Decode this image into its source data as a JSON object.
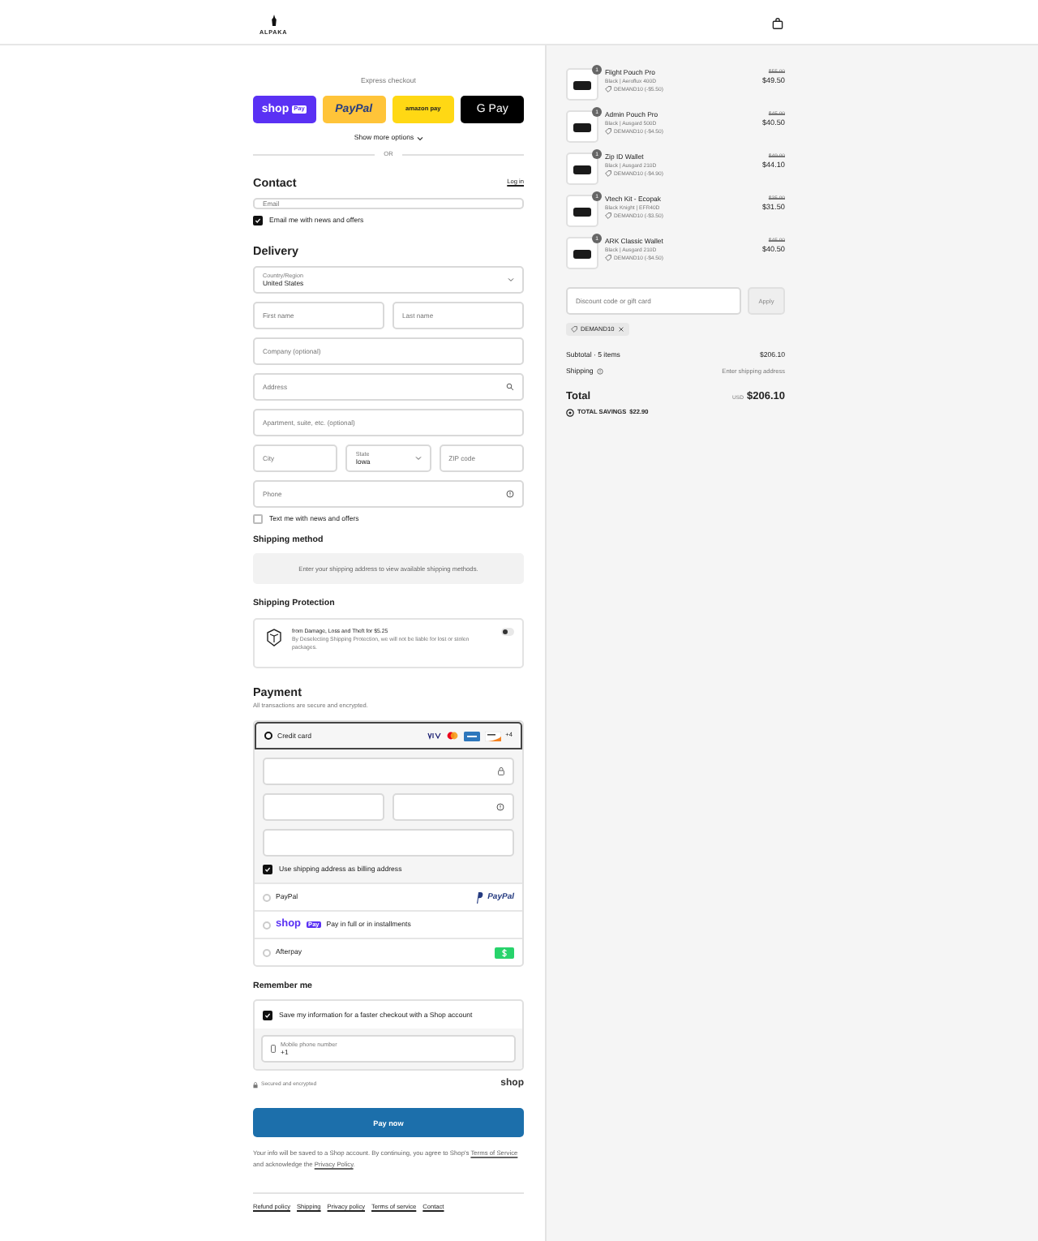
{
  "header": {
    "logo": "ALPAKA"
  },
  "express": {
    "label": "Express checkout",
    "buttons": [
      {
        "kind": "shop",
        "label": "shop",
        "badge": "Pay"
      },
      {
        "kind": "paypal",
        "label": "PayPal"
      },
      {
        "kind": "amazon",
        "label": "amazon pay"
      },
      {
        "kind": "gpay",
        "label": "G Pay"
      }
    ],
    "show_more": "Show more options",
    "divider": "OR"
  },
  "contact": {
    "heading": "Contact",
    "login": "Log in",
    "email": {
      "placeholder": "Email"
    },
    "news": {
      "label": "Email me with news and offers",
      "checked": true
    }
  },
  "delivery": {
    "heading": "Delivery",
    "rows": [
      [
        {
          "kind": "select",
          "label": "Country/Region",
          "value": "United States"
        }
      ],
      [
        {
          "kind": "text",
          "placeholder": "First name"
        },
        {
          "kind": "text",
          "placeholder": "Last name"
        }
      ],
      [
        {
          "kind": "text",
          "placeholder": "Company (optional)"
        }
      ],
      [
        {
          "kind": "search",
          "placeholder": "Address"
        }
      ],
      [
        {
          "kind": "text",
          "placeholder": "Apartment, suite, etc. (optional)"
        }
      ],
      [
        {
          "kind": "text",
          "placeholder": "City"
        },
        {
          "kind": "select",
          "label": "State",
          "value": "Iowa"
        },
        {
          "kind": "text",
          "placeholder": "ZIP code"
        }
      ],
      [
        {
          "kind": "help",
          "placeholder": "Phone"
        }
      ]
    ],
    "sms": {
      "label": "Text me with news and offers",
      "checked": false
    }
  },
  "shipping_method": {
    "heading": "Shipping method",
    "message": "Enter your shipping address to view available shipping methods."
  },
  "shipping_protection": {
    "heading": "Shipping Protection",
    "title": "from Damage, Loss and Theft for $5.25",
    "description": "By Deselecting Shipping Protection, we will not be liable for lost or stolen packages.",
    "on": false
  },
  "payment": {
    "heading": "Payment",
    "subtitle": "All transactions are secure and encrypted.",
    "more_cards": "+4",
    "card_fields": [
      [
        {
          "kind": "lock"
        }
      ],
      [
        {
          "kind": "plain"
        },
        {
          "kind": "help"
        }
      ],
      [
        {
          "kind": "plain"
        }
      ]
    ],
    "billing": {
      "label": "Use shipping address as billing address",
      "checked": true
    },
    "methods": [
      {
        "kind": "card",
        "label": "Credit card",
        "selected": true
      },
      {
        "kind": "paypal",
        "label": "PayPal",
        "logo": "PayPal",
        "selected": false
      },
      {
        "kind": "shop",
        "logo": "shop",
        "badge": "Pay",
        "label": "Pay in full or in installments",
        "selected": false
      },
      {
        "kind": "afterpay",
        "label": "Afterpay",
        "selected": false
      }
    ]
  },
  "remember": {
    "heading": "Remember me",
    "save": {
      "label": "Save my information for a faster checkout with a Shop account",
      "checked": true
    },
    "phone": {
      "label": "Mobile phone number",
      "value": "+1"
    },
    "secured": "Secured and encrypted",
    "shop_logo": "shop"
  },
  "pay_button": "Pay now",
  "disclaimer": {
    "text": "Your info will be saved to a Shop account. By continuing, you agree to Shop's",
    "terms": "Terms of Service",
    "middle": "and acknowledge the",
    "privacy": "Privacy Policy",
    "end": "."
  },
  "footer_links": [
    "Refund policy",
    "Shipping",
    "Privacy policy",
    "Terms of service",
    "Contact"
  ],
  "summary": {
    "items": [
      {
        "name": "Flight Pouch Pro",
        "variant": "Black | Aeroflux 400D",
        "discount": "DEMAND10 (-$5.50)",
        "original": "$55.00",
        "price": "$49.50",
        "quantity": "1"
      },
      {
        "name": "Admin Pouch Pro",
        "variant": "Black | Ausgard 500D",
        "discount": "DEMAND10 (-$4.50)",
        "original": "$45.00",
        "price": "$40.50",
        "quantity": "1"
      },
      {
        "name": "Zip ID Wallet",
        "variant": "Black | Ausgard 210D",
        "discount": "DEMAND10 (-$4.90)",
        "original": "$49.00",
        "price": "$44.10",
        "quantity": "1"
      },
      {
        "name": "Vtech Kit - Ecopak",
        "variant": "Black Knight | EFR40D",
        "discount": "DEMAND10 (-$3.50)",
        "original": "$35.00",
        "price": "$31.50",
        "quantity": "1"
      },
      {
        "name": "ARK Classic Wallet",
        "variant": "Black | Ausgard 210D",
        "discount": "DEMAND10 (-$4.50)",
        "original": "$45.00",
        "price": "$40.50",
        "quantity": "1"
      }
    ],
    "discount_placeholder": "Discount code or gift card",
    "apply": "Apply",
    "applied_code": "DEMAND10",
    "subtotal_label": "Subtotal · 5 items",
    "subtotal": "$206.10",
    "shipping_label": "Shipping",
    "shipping": "Enter shipping address",
    "total_label": "Total",
    "currency": "USD",
    "total": "$206.10",
    "savings_label": "TOTAL SAVINGS",
    "savings": "$22.90"
  }
}
